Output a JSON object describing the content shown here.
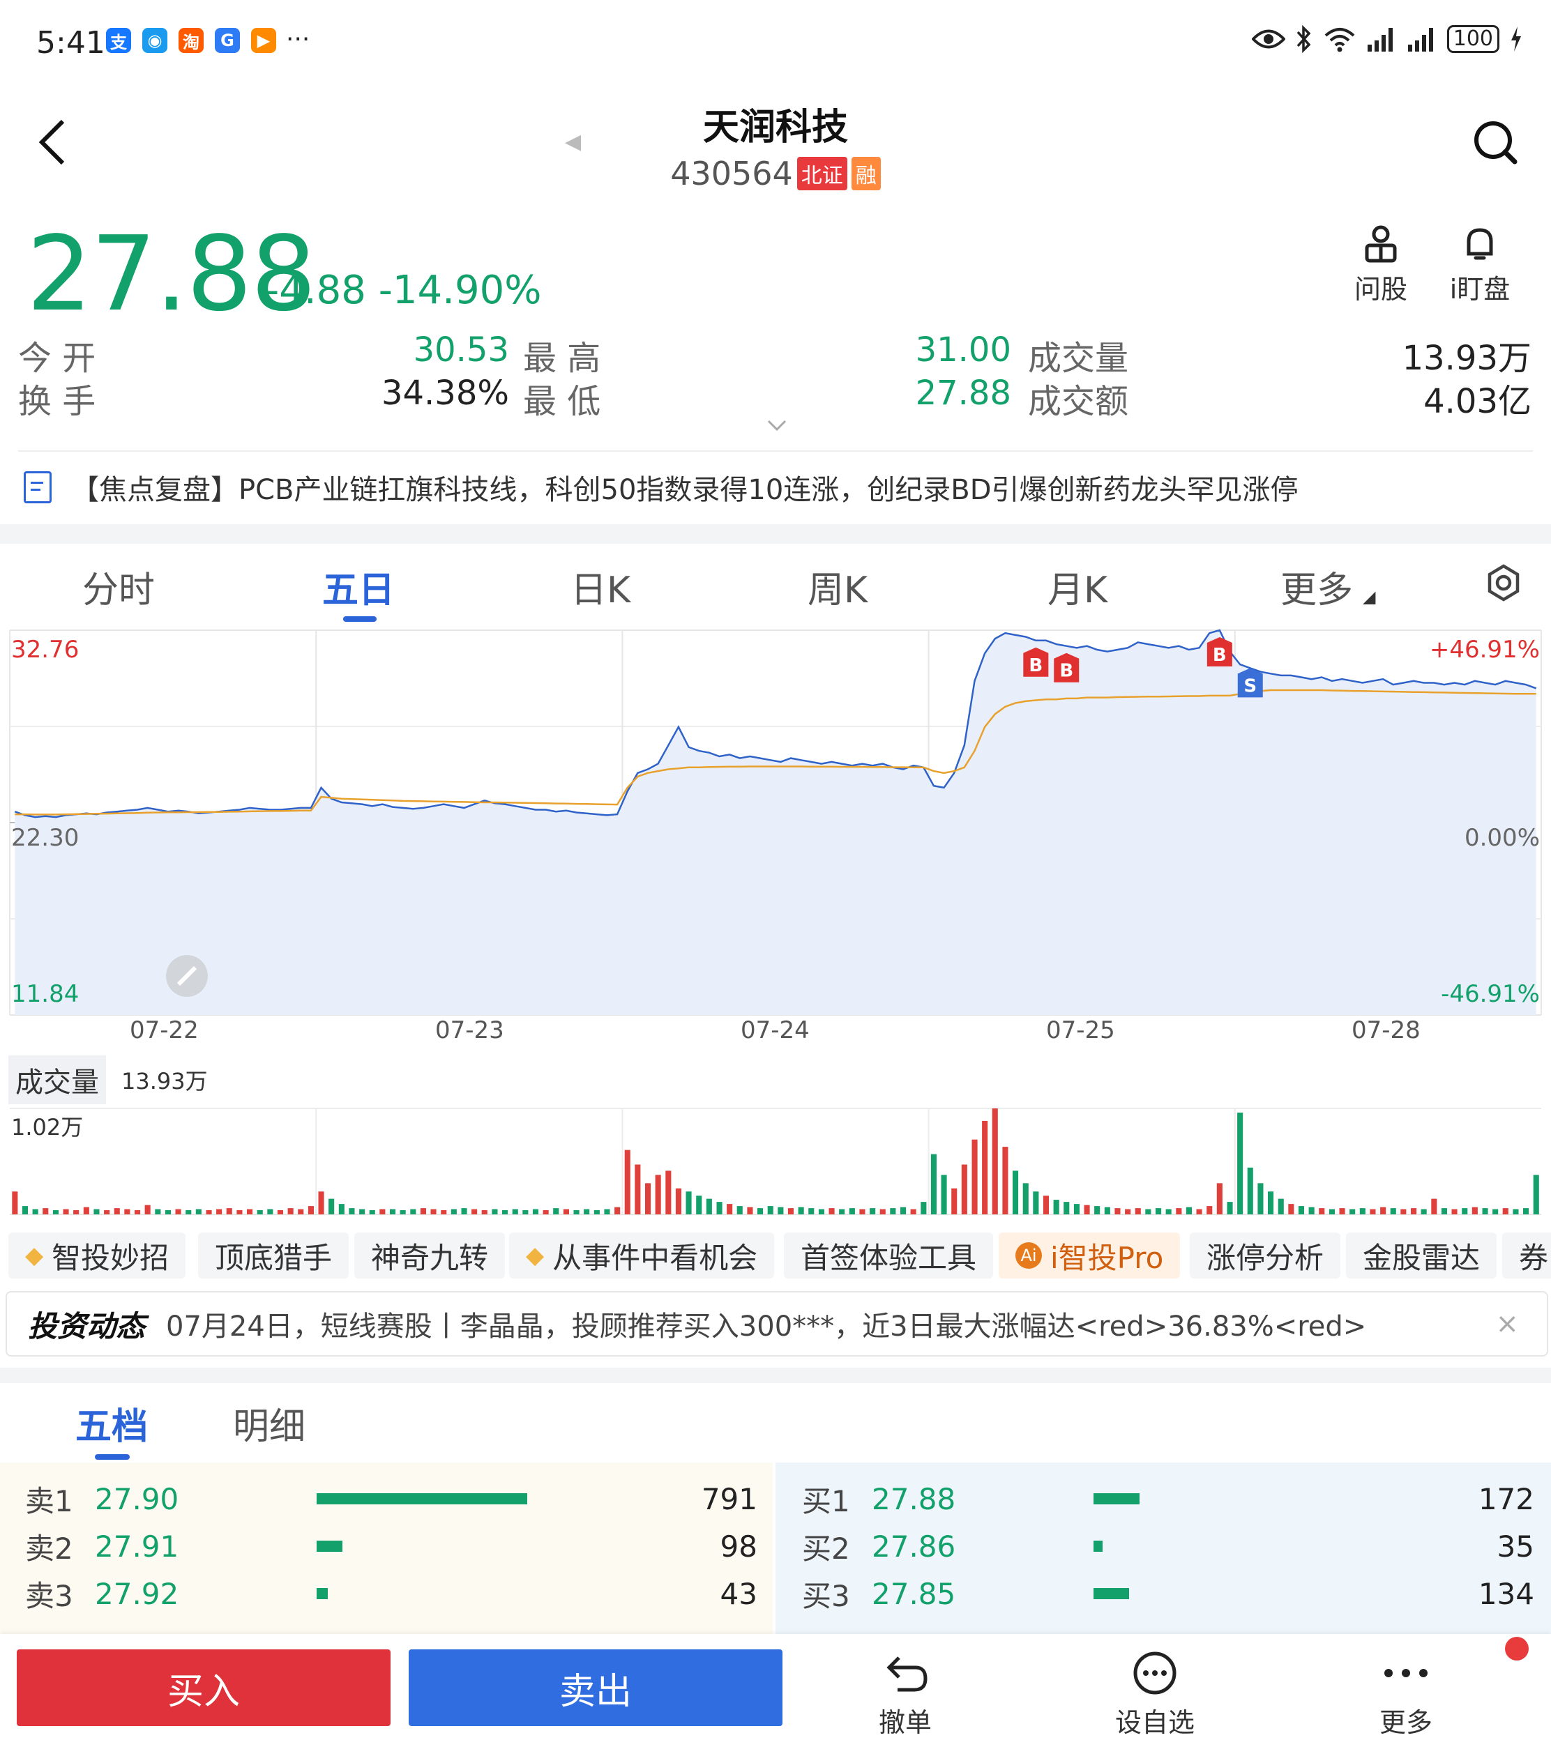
{
  "status": {
    "time": "5:41",
    "app_icons": [
      {
        "icon": "alipay-icon",
        "glyph": "支",
        "color": "#1677ff"
      },
      {
        "icon": "messenger-icon",
        "glyph": "◉",
        "color": "#1a9bf0"
      },
      {
        "icon": "taobao-icon",
        "glyph": "淘",
        "color": "#ff5a00"
      },
      {
        "icon": "browser-icon",
        "glyph": "G",
        "color": "#2d7cf6"
      },
      {
        "icon": "video-icon",
        "glyph": "▶",
        "color": "#ff8a00"
      }
    ],
    "more": "···",
    "battery": "100"
  },
  "header": {
    "title": "天润科技",
    "code": "430564",
    "tags": [
      {
        "text": "北证",
        "color": "#e8393d"
      },
      {
        "text": "融",
        "color": "#ff8a3d"
      }
    ]
  },
  "quote": {
    "price": "27.88",
    "change": "-4.88  -14.90%",
    "actions": [
      {
        "label": "问股",
        "icon": "ask-stock-icon"
      },
      {
        "label": "i盯盘",
        "icon": "bell-icon"
      }
    ],
    "stats": {
      "open_label": "今  开",
      "open": "30.53",
      "high_label": "最  高",
      "high": "31.00",
      "volume_label": "成交量",
      "volume": "13.93万",
      "turnover_label": "换  手",
      "turnover": "34.38%",
      "low_label": "最  低",
      "low": "27.88",
      "amount_label": "成交额",
      "amount": "4.03亿"
    }
  },
  "news": {
    "text": "【焦点复盘】PCB产业链扛旗科技线，科创50指数录得10连涨，创纪录BD引爆创新药龙头罕见涨停"
  },
  "chart_tabs": [
    "分时",
    "五日",
    "日K",
    "周K",
    "月K",
    "更多"
  ],
  "chart_active_tab": 1,
  "chart_data": {
    "type": "line",
    "title": "",
    "x": [
      "07-22",
      "07-23",
      "07-24",
      "07-25",
      "07-28"
    ],
    "y_axis_left": [
      "32.76",
      "22.30",
      "11.84"
    ],
    "y_axis_right": [
      "+46.91%",
      "0.00%",
      "-46.91%"
    ],
    "ylim": [
      11.84,
      32.76
    ],
    "prev_close": 22.3,
    "series": [
      {
        "role": "price",
        "color": "#2e62c9",
        "values": [
          22.9,
          22.7,
          22.6,
          22.65,
          22.6,
          22.7,
          22.75,
          22.8,
          22.75,
          22.85,
          22.9,
          22.95,
          23.0,
          23.1,
          23.0,
          22.9,
          22.95,
          22.9,
          22.8,
          22.85,
          22.9,
          22.95,
          23.0,
          23.1,
          23.05,
          23.0,
          23.0,
          23.05,
          23.1,
          23.1,
          24.2,
          23.6,
          23.4,
          23.35,
          23.3,
          23.2,
          23.3,
          23.15,
          23.1,
          23.05,
          23.1,
          23.2,
          23.3,
          23.2,
          23.1,
          23.3,
          23.5,
          23.35,
          23.3,
          23.2,
          23.1,
          23.0,
          23.0,
          22.9,
          22.95,
          22.85,
          22.8,
          22.75,
          22.7,
          22.75,
          24.0,
          25.0,
          25.2,
          25.5,
          26.5,
          27.5,
          26.4,
          26.2,
          26.1,
          25.9,
          26.0,
          25.8,
          25.9,
          25.8,
          25.7,
          25.6,
          25.8,
          25.7,
          25.6,
          25.5,
          25.6,
          25.5,
          25.4,
          25.5,
          25.4,
          25.5,
          25.3,
          25.2,
          25.4,
          25.3,
          24.3,
          24.2,
          25.0,
          26.5,
          30.0,
          31.5,
          32.3,
          32.6,
          32.5,
          32.4,
          32.2,
          32.2,
          32.0,
          31.9,
          31.8,
          31.9,
          31.7,
          31.6,
          31.7,
          31.8,
          32.1,
          32.0,
          31.9,
          31.8,
          31.9,
          31.7,
          31.8,
          32.6,
          32.76,
          31.6,
          30.9,
          30.7,
          30.5,
          30.4,
          30.3,
          30.3,
          30.2,
          30.1,
          30.2,
          30.0,
          30.1,
          30.0,
          29.9,
          30.0,
          30.1,
          29.8,
          29.9,
          30.0,
          29.9,
          29.9,
          29.8,
          29.9,
          29.8,
          30.0,
          29.9,
          29.8,
          30.0,
          29.9,
          29.8,
          29.6
        ]
      },
      {
        "role": "average",
        "color": "#e7a12c",
        "values": [
          22.75,
          22.75,
          22.74,
          22.74,
          22.74,
          22.75,
          22.76,
          22.77,
          22.78,
          22.79,
          22.8,
          22.81,
          22.82,
          22.84,
          22.85,
          22.86,
          22.86,
          22.87,
          22.87,
          22.88,
          22.88,
          22.89,
          22.9,
          22.91,
          22.92,
          22.93,
          22.93,
          22.94,
          22.95,
          22.95,
          23.7,
          23.65,
          23.6,
          23.58,
          23.56,
          23.54,
          23.52,
          23.5,
          23.48,
          23.47,
          23.46,
          23.45,
          23.44,
          23.43,
          23.42,
          23.41,
          23.4,
          23.4,
          23.39,
          23.38,
          23.37,
          23.36,
          23.35,
          23.34,
          23.33,
          23.32,
          23.31,
          23.3,
          23.29,
          23.28,
          24.2,
          24.8,
          25.0,
          25.1,
          25.2,
          25.25,
          25.3,
          25.3,
          25.32,
          25.33,
          25.34,
          25.34,
          25.35,
          25.35,
          25.35,
          25.35,
          25.35,
          25.35,
          25.34,
          25.34,
          25.34,
          25.33,
          25.33,
          25.33,
          25.32,
          25.32,
          25.31,
          25.31,
          25.3,
          25.3,
          25.1,
          25.0,
          25.1,
          25.3,
          26.2,
          27.5,
          28.2,
          28.6,
          28.8,
          28.9,
          28.95,
          29.0,
          29.0,
          29.05,
          29.05,
          29.1,
          29.1,
          29.1,
          29.12,
          29.13,
          29.14,
          29.15,
          29.15,
          29.16,
          29.17,
          29.18,
          29.18,
          29.2,
          29.2,
          29.2,
          29.3,
          29.4,
          29.45,
          29.5,
          29.5,
          29.5,
          29.5,
          29.5,
          29.5,
          29.48,
          29.47,
          29.46,
          29.45,
          29.44,
          29.43,
          29.42,
          29.41,
          29.4,
          29.39,
          29.38,
          29.37,
          29.36,
          29.35,
          29.34,
          29.33,
          29.32,
          29.31,
          29.3,
          29.3,
          29.3
        ]
      }
    ],
    "markers": [
      {
        "label": "B",
        "color": "#e03030",
        "at_index": 100
      },
      {
        "label": "B",
        "color": "#e03030",
        "at_index": 103
      },
      {
        "label": "B",
        "color": "#e03030",
        "at_index": 118
      },
      {
        "label": "S",
        "color": "#3a6fd8",
        "at_index": 121
      }
    ],
    "volume": {
      "label": "成交量",
      "value": "13.93万",
      "max_label": "1.02万",
      "ylim": [
        0,
        1.02
      ],
      "values": [
        0.22,
        0.08,
        0.05,
        0.06,
        0.04,
        0.05,
        0.04,
        0.07,
        0.05,
        0.04,
        0.06,
        0.05,
        0.04,
        0.09,
        0.05,
        0.04,
        0.05,
        0.04,
        0.05,
        0.04,
        0.05,
        0.06,
        0.04,
        0.05,
        0.04,
        0.05,
        0.04,
        0.06,
        0.05,
        0.08,
        0.22,
        0.15,
        0.1,
        0.06,
        0.05,
        0.04,
        0.05,
        0.05,
        0.04,
        0.05,
        0.06,
        0.05,
        0.04,
        0.05,
        0.06,
        0.05,
        0.04,
        0.05,
        0.04,
        0.05,
        0.04,
        0.05,
        0.04,
        0.06,
        0.05,
        0.04,
        0.05,
        0.04,
        0.05,
        0.07,
        0.62,
        0.48,
        0.3,
        0.38,
        0.42,
        0.25,
        0.22,
        0.18,
        0.15,
        0.12,
        0.1,
        0.08,
        0.07,
        0.06,
        0.08,
        0.07,
        0.06,
        0.07,
        0.06,
        0.05,
        0.06,
        0.05,
        0.06,
        0.05,
        0.06,
        0.05,
        0.06,
        0.07,
        0.05,
        0.12,
        0.58,
        0.38,
        0.25,
        0.48,
        0.72,
        0.9,
        1.02,
        0.65,
        0.42,
        0.3,
        0.22,
        0.18,
        0.14,
        0.12,
        0.1,
        0.09,
        0.08,
        0.07,
        0.06,
        0.05,
        0.06,
        0.05,
        0.06,
        0.05,
        0.06,
        0.07,
        0.05,
        0.08,
        0.3,
        0.12,
        0.98,
        0.45,
        0.3,
        0.22,
        0.15,
        0.1,
        0.08,
        0.07,
        0.06,
        0.05,
        0.06,
        0.05,
        0.06,
        0.05,
        0.07,
        0.06,
        0.05,
        0.06,
        0.05,
        0.15,
        0.06,
        0.05,
        0.06,
        0.07,
        0.06,
        0.05,
        0.06,
        0.05,
        0.06,
        0.38
      ]
    }
  },
  "tools": [
    {
      "label": "智投妙招",
      "icon": "diamond-icon"
    },
    {
      "label": "顶底猎手"
    },
    {
      "label": "神奇九转"
    },
    {
      "label": "从事件中看机会",
      "icon": "diamond-icon"
    },
    {
      "label": "首签体验工具"
    },
    {
      "label": "i智投Pro",
      "icon": "ai-icon"
    },
    {
      "label": "涨停分析"
    },
    {
      "label": "金股雷达"
    },
    {
      "label": "券"
    }
  ],
  "invest": {
    "brand": "投资动态",
    "text": "07月24日，短线赛股丨李晶晶，投顾推荐买入300***，近3日最大涨幅达<red>36.83%<red>",
    "close": "×"
  },
  "depth_tabs": [
    "五档",
    "明细"
  ],
  "depth_active_tab": 0,
  "orderbook": {
    "sells": [
      {
        "label": "卖1",
        "price": "27.90",
        "qty": "791"
      },
      {
        "label": "卖2",
        "price": "27.91",
        "qty": "98"
      },
      {
        "label": "卖3",
        "price": "27.92",
        "qty": "43"
      }
    ],
    "buys": [
      {
        "label": "买1",
        "price": "27.88",
        "qty": "172"
      },
      {
        "label": "买2",
        "price": "27.86",
        "qty": "35"
      },
      {
        "label": "买3",
        "price": "27.85",
        "qty": "134"
      }
    ],
    "max_qty": 791
  },
  "bottom": {
    "buy": "买入",
    "sell": "卖出",
    "actions": [
      {
        "label": "撤单",
        "icon": "undo-icon"
      },
      {
        "label": "设自选",
        "icon": "add-watchlist-icon"
      },
      {
        "label": "更多",
        "icon": "more-icon"
      }
    ]
  }
}
